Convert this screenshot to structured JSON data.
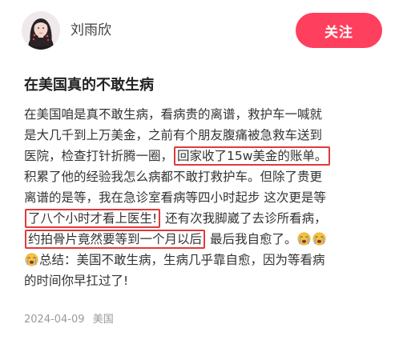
{
  "header": {
    "author_name": "刘雨欣",
    "follow_label": "关注"
  },
  "post": {
    "title": "在美国真的不敢生病",
    "lines": [
      {
        "parts": [
          {
            "text": "在美国咱是真不敢生病，看病贵的离谱，救护车一喊就"
          }
        ]
      },
      {
        "parts": [
          {
            "text": "是大几千到上万美金，之前有个朋友腹痛被急救车送到"
          }
        ]
      },
      {
        "parts": [
          {
            "text": "医院，检查打针折腾一圈，"
          },
          {
            "text": "回家收了15w美金的账单。",
            "hl": true
          }
        ]
      },
      {
        "parts": [
          {
            "text": "积累了他的经验我怎么病都不敢打救护车。但除了贵更"
          }
        ]
      },
      {
        "parts": [
          {
            "text": "离谱的是等，我在急诊室看病等四小时起步 这次更是等"
          }
        ]
      },
      {
        "parts": [
          {
            "text": "了八个小时才看上医生!",
            "hl": true
          },
          {
            "text": " 还有次我脚崴了去诊所看病，"
          }
        ]
      },
      {
        "parts": [
          {
            "text": "约拍骨片竟然要等到一个月以后",
            "hl": true
          },
          {
            "text": "  最后我自愈了。"
          },
          {
            "emoji": "crying-face-icon"
          },
          {
            "emoji": "crying-face-icon"
          }
        ]
      },
      {
        "parts": [
          {
            "emoji": "crying-face-icon"
          },
          {
            "text": "总结：美国不敢生病，生病几乎靠自愈，因为等看病"
          }
        ]
      },
      {
        "parts": [
          {
            "text": "的时间你早扛过了!"
          }
        ]
      }
    ],
    "date": "2024-04-09",
    "location": "美国"
  },
  "colors": {
    "follow_button": "#fe3f5e",
    "highlight_border": "#e03a3a"
  }
}
